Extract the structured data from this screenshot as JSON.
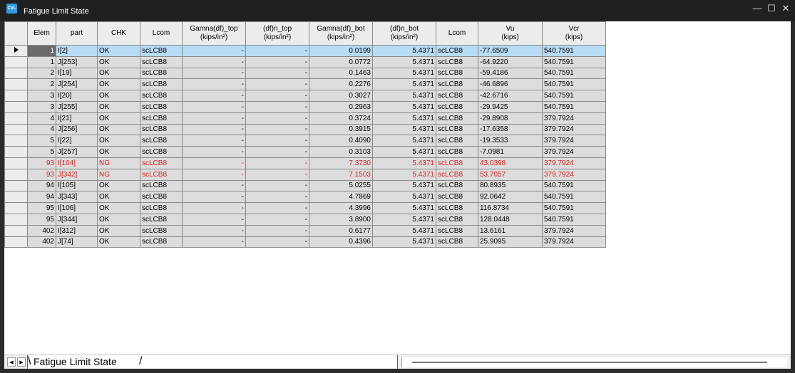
{
  "window": {
    "title": "Fatigue Limit State",
    "app_icon_text": "CVL"
  },
  "controls": {
    "minimize": "—",
    "maximize": "☐",
    "close": "✕"
  },
  "columns": [
    {
      "l1": "Elem",
      "l2": ""
    },
    {
      "l1": "part",
      "l2": ""
    },
    {
      "l1": "CHK",
      "l2": ""
    },
    {
      "l1": "Lcom",
      "l2": ""
    },
    {
      "l1": "Gamna(df)_top",
      "l2": "(kips/in²)"
    },
    {
      "l1": "(df)n_top",
      "l2": "(kips/in²)"
    },
    {
      "l1": "Gamna(df)_bot",
      "l2": "(kips/in²)"
    },
    {
      "l1": "(df)n_bot",
      "l2": "(kips/in²)"
    },
    {
      "l1": "Lcom",
      "l2": ""
    },
    {
      "l1": "Vu",
      "l2": "(kips)"
    },
    {
      "l1": "Vcr",
      "l2": "(kips)"
    }
  ],
  "rows": [
    {
      "elem": "1",
      "part": "I[2]",
      "chk": "OK",
      "lcom": "scLCB8",
      "gtop": "-",
      "ntop": "-",
      "gbot": "0.0199",
      "nbot": "5.4371",
      "lcom2": "scLCB8",
      "vu": "-77.6509",
      "vcr": "540.7591",
      "status": "ok",
      "selected": true
    },
    {
      "elem": "1",
      "part": "J[253]",
      "chk": "OK",
      "lcom": "scLCB8",
      "gtop": "-",
      "ntop": "-",
      "gbot": "0.0772",
      "nbot": "5.4371",
      "lcom2": "scLCB8",
      "vu": "-64.9220",
      "vcr": "540.7591",
      "status": "ok"
    },
    {
      "elem": "2",
      "part": "I[19]",
      "chk": "OK",
      "lcom": "scLCB8",
      "gtop": "-",
      "ntop": "-",
      "gbot": "0.1463",
      "nbot": "5.4371",
      "lcom2": "scLCB8",
      "vu": "-59.4186",
      "vcr": "540.7591",
      "status": "ok"
    },
    {
      "elem": "2",
      "part": "J[254]",
      "chk": "OK",
      "lcom": "scLCB8",
      "gtop": "-",
      "ntop": "-",
      "gbot": "0.2276",
      "nbot": "5.4371",
      "lcom2": "scLCB8",
      "vu": "-46.6896",
      "vcr": "540.7591",
      "status": "ok"
    },
    {
      "elem": "3",
      "part": "I[20]",
      "chk": "OK",
      "lcom": "scLCB8",
      "gtop": "-",
      "ntop": "-",
      "gbot": "0.3027",
      "nbot": "5.4371",
      "lcom2": "scLCB8",
      "vu": "-42.6716",
      "vcr": "540.7591",
      "status": "ok"
    },
    {
      "elem": "3",
      "part": "J[255]",
      "chk": "OK",
      "lcom": "scLCB8",
      "gtop": "-",
      "ntop": "-",
      "gbot": "0.2963",
      "nbot": "5.4371",
      "lcom2": "scLCB8",
      "vu": "-29.9425",
      "vcr": "540.7591",
      "status": "ok"
    },
    {
      "elem": "4",
      "part": "I[21]",
      "chk": "OK",
      "lcom": "scLCB8",
      "gtop": "-",
      "ntop": "-",
      "gbot": "0.3724",
      "nbot": "5.4371",
      "lcom2": "scLCB8",
      "vu": "-29.8908",
      "vcr": "379.7924",
      "status": "ok"
    },
    {
      "elem": "4",
      "part": "J[256]",
      "chk": "OK",
      "lcom": "scLCB8",
      "gtop": "-",
      "ntop": "-",
      "gbot": "0.3915",
      "nbot": "5.4371",
      "lcom2": "scLCB8",
      "vu": "-17.6358",
      "vcr": "379.7924",
      "status": "ok"
    },
    {
      "elem": "5",
      "part": "I[22]",
      "chk": "OK",
      "lcom": "scLCB8",
      "gtop": "-",
      "ntop": "-",
      "gbot": "0.4090",
      "nbot": "5.4371",
      "lcom2": "scLCB8",
      "vu": "-19.3533",
      "vcr": "379.7924",
      "status": "ok"
    },
    {
      "elem": "5",
      "part": "J[257]",
      "chk": "OK",
      "lcom": "scLCB8",
      "gtop": "-",
      "ntop": "-",
      "gbot": "0.3103",
      "nbot": "5.4371",
      "lcom2": "scLCB8",
      "vu": "-7.0981",
      "vcr": "379.7924",
      "status": "ok"
    },
    {
      "elem": "93",
      "part": "I[104]",
      "chk": "NG",
      "lcom": "scLCB8",
      "gtop": "-",
      "ntop": "-",
      "gbot": "7.3730",
      "nbot": "5.4371",
      "lcom2": "scLCB8",
      "vu": "43.0398",
      "vcr": "379.7924",
      "status": "ng"
    },
    {
      "elem": "93",
      "part": "J[342]",
      "chk": "NG",
      "lcom": "scLCB8",
      "gtop": "-",
      "ntop": "-",
      "gbot": "7.1503",
      "nbot": "5.4371",
      "lcom2": "scLCB8",
      "vu": "53.7057",
      "vcr": "379.7924",
      "status": "ng"
    },
    {
      "elem": "94",
      "part": "I[105]",
      "chk": "OK",
      "lcom": "scLCB8",
      "gtop": "-",
      "ntop": "-",
      "gbot": "5.0255",
      "nbot": "5.4371",
      "lcom2": "scLCB8",
      "vu": "80.8935",
      "vcr": "540.7591",
      "status": "ok"
    },
    {
      "elem": "94",
      "part": "J[343]",
      "chk": "OK",
      "lcom": "scLCB8",
      "gtop": "-",
      "ntop": "-",
      "gbot": "4.7869",
      "nbot": "5.4371",
      "lcom2": "scLCB8",
      "vu": "92.0642",
      "vcr": "540.7591",
      "status": "ok"
    },
    {
      "elem": "95",
      "part": "I[106]",
      "chk": "OK",
      "lcom": "scLCB8",
      "gtop": "-",
      "ntop": "-",
      "gbot": "4.3996",
      "nbot": "5.4371",
      "lcom2": "scLCB8",
      "vu": "116.8734",
      "vcr": "540.7591",
      "status": "ok"
    },
    {
      "elem": "95",
      "part": "J[344]",
      "chk": "OK",
      "lcom": "scLCB8",
      "gtop": "-",
      "ntop": "-",
      "gbot": "3.8900",
      "nbot": "5.4371",
      "lcom2": "scLCB8",
      "vu": "128.0448",
      "vcr": "540.7591",
      "status": "ok"
    },
    {
      "elem": "402",
      "part": "I[312]",
      "chk": "OK",
      "lcom": "scLCB8",
      "gtop": "-",
      "ntop": "-",
      "gbot": "0.6177",
      "nbot": "5.4371",
      "lcom2": "scLCB8",
      "vu": "13.6161",
      "vcr": "379.7924",
      "status": "ok"
    },
    {
      "elem": "402",
      "part": "J[74]",
      "chk": "OK",
      "lcom": "scLCB8",
      "gtop": "-",
      "ntop": "-",
      "gbot": "0.4396",
      "nbot": "5.4371",
      "lcom2": "scLCB8",
      "vu": "25.9095",
      "vcr": "379.7924",
      "status": "ok"
    }
  ],
  "sheet_tabs": [
    {
      "label": "Fatigue Limit State"
    }
  ],
  "nav": {
    "prev": "◀",
    "next": "▶"
  },
  "colors": {
    "ng_text": "#e02020",
    "selected_row": "#b7dcf5",
    "cell_bg": "#dcdcdc"
  }
}
